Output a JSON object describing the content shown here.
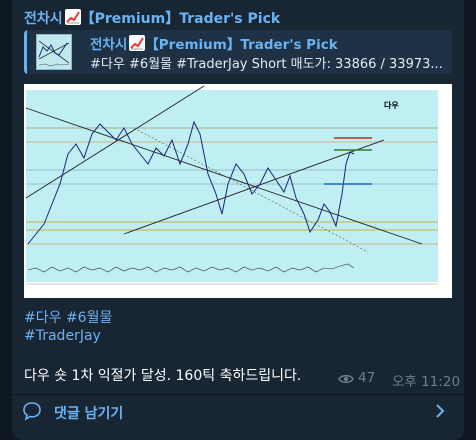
{
  "channel": {
    "title_prefix": "전차시",
    "title_suffix": "【Premium】Trader's Pick"
  },
  "reply": {
    "title_prefix": "전차시",
    "title_suffix": "【Premium】Trader's Pick",
    "text": "#다우 #6월물 #TraderJay  Short 매도가: 33866 / 33973..."
  },
  "chart_image": {
    "overlay_label": "다우",
    "background_color": "#bfeff2"
  },
  "hashtags": {
    "line1": "#다우 #6월물",
    "line2": "#TraderJay"
  },
  "message": "다우 숏 1차 익절가 달성. 160틱 축하드립니다.",
  "meta": {
    "views": "47",
    "time": "오후 11:20"
  },
  "comments": {
    "label": "댓글 남기기"
  },
  "colors": {
    "accent": "#6ab3f3",
    "bubble": "#182533",
    "page": "#0e1621"
  }
}
